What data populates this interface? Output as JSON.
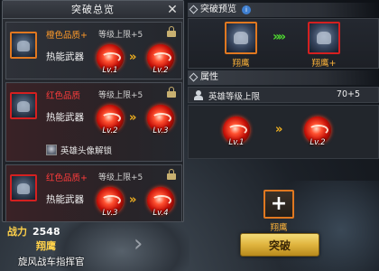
{
  "summary": {
    "title": "突破总览",
    "rows": [
      {
        "quality": "橙色品质+",
        "quality_color": "#ff9a2a",
        "condition": "等级上限+5",
        "weapon_label": "热能武器",
        "from_level": "Lv.1",
        "to_level": "Lv.2",
        "extra": null
      },
      {
        "quality": "红色品质",
        "quality_color": "#ff3c3c",
        "condition": "等级上限+5",
        "weapon_label": "热能武器",
        "from_level": "Lv.2",
        "to_level": "Lv.3",
        "extra": "英雄头像解锁"
      },
      {
        "quality": "红色品质+",
        "quality_color": "#ff3c3c",
        "condition": "等级上限+5",
        "weapon_label": "热能武器",
        "from_level": "Lv.3",
        "to_level": "Lv.4",
        "extra": null
      }
    ]
  },
  "hero": {
    "power_label": "战力",
    "power_value": "2548",
    "name": "翔鹰",
    "title": "旋风战车指挥官"
  },
  "preview": {
    "title": "突破预览",
    "from_name": "翔鹰",
    "to_name": "翔鹰+"
  },
  "attributes": {
    "title": "属性",
    "row_label": "英雄等级上限",
    "row_value": "70+5",
    "skill_from": "Lv.1",
    "skill_to": "Lv.2"
  },
  "material": {
    "name": "翔鹰"
  },
  "actions": {
    "break_label": "突破"
  },
  "icons": {
    "close": "close-icon",
    "lock": "lock-icon",
    "info": "info-icon",
    "arrow": "double-chevron-right-icon"
  }
}
